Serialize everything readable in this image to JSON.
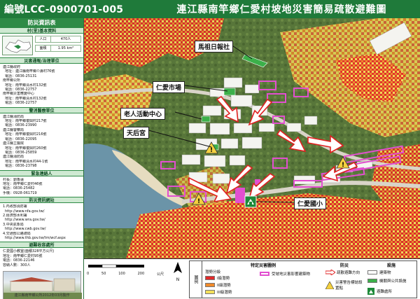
{
  "header": {
    "code": "編號LCC-0900701-005",
    "title": "連江縣南竿鄉仁愛村坡地災害簡易疏散避難圖"
  },
  "panel": {
    "title": "防災資訊表",
    "basic": {
      "heading": "村(里)基本資料",
      "population_label": "人口",
      "population_value": "470人",
      "area_label": "面積",
      "area_value": "1.95 km²"
    },
    "notify": {
      "heading": "災害通報/治理單位",
      "lines": [
        "連江縣政府",
        "地址：連江縣南竿鄉介壽村76號",
        "電話：0836-25131",
        "南竿鄉公所",
        "地址：南竿鄉清水村132號",
        "電話：0836-22757",
        "南竿鄉災害應變中心",
        "地址：南竿鄉清水村132號",
        "電話：0836-22757"
      ]
    },
    "rescue": {
      "heading": "警消醫療單位",
      "lines": [
        "連江縣消防局",
        "地址：南竿鄉復興村217號",
        "電話：0836-23990",
        "連江縣警察局",
        "地址：南竿鄉復興村216號",
        "電話：0836-22095",
        "連江縣立醫院",
        "地址：南竿鄉復興村260號",
        "電話：0836-25859",
        "連江縣消防局",
        "地址：南竿鄉清水村44-1號",
        "電話：0836-23798"
      ]
    },
    "contact": {
      "heading": "緊急連絡人",
      "lines": [
        "村長：劉香蓮",
        "地址：南竿鄉仁愛村46號",
        "電話：0836-25482",
        "手機：0928-061719"
      ]
    },
    "links": {
      "heading": "防災資訊網站",
      "lines": [
        "1.內政部消防署",
        "http://www.nfa.gov.tw/",
        "2.經濟部水利署",
        "http://www.wra.gov.tw/",
        "3.中央氣象局",
        "http://www.cwb.gov.tw/",
        "4.交通部公路總局",
        "http://www.thb.gov.tw/tm/wcf.aspx"
      ]
    },
    "shelter": {
      "heading": "避難收容處所",
      "lines": [
        "仁愛國小教室(面積328平方公尺)",
        "地址：南竿鄉仁愛村95號",
        "電話：0836-22146",
        "容納人數：300人"
      ]
    },
    "footer": "連江縣南竿鄉公所2012年03月製作"
  },
  "map": {
    "labels": {
      "newspaper": "馬祖日報社",
      "market": "仁愛市場",
      "senior_center": "老人活動中心",
      "temple": "天后宮",
      "school": "仁愛國小"
    },
    "colors": {
      "landslide_1": "#f4e05a",
      "landslide_2": "#f08a2a",
      "landslide_3": "#e22a2a",
      "affected_building": "#e24fd0",
      "route": "#e02020",
      "facility_green": "#3cb04a",
      "sea": "#6b94a8"
    }
  },
  "legend": {
    "scale_labels": [
      "0",
      "50",
      "100",
      "200",
      "公尺"
    ],
    "north": "N",
    "title": "圖例",
    "hazard_heading": "特定災害圖例",
    "prevention_heading": "防災",
    "facility_heading": "設施",
    "slope_grade": "潛勢分級",
    "grade_1": "I級潛勢",
    "grade_2": "II級潛勢",
    "grade_3": "III級潛勢",
    "affected": "受坡地災害影響建築物",
    "evac_direction": "疏散避難方向",
    "warning": "災害警告標誌設置點",
    "building": "建築物",
    "public_facility": "機關與公共設施",
    "shelter": "避難處所"
  }
}
